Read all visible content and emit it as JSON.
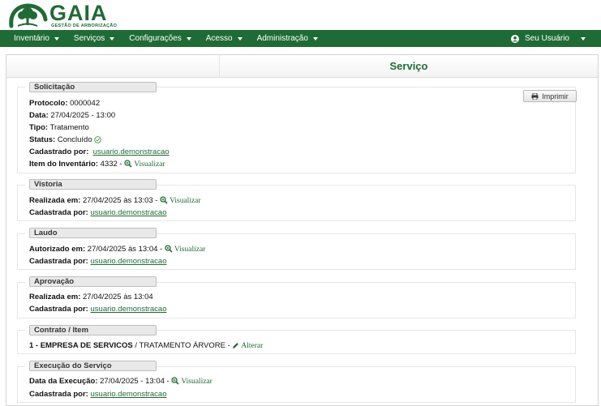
{
  "brand": {
    "name": "GAIA",
    "tagline": "GESTÃO DE ARBORIZAÇÃO"
  },
  "nav": {
    "items": [
      "Inventário",
      "Serviços",
      "Configurações",
      "Acesso",
      "Administração"
    ],
    "user": "Seu Usuário"
  },
  "colors": {
    "brand_green": "#1f6b35"
  },
  "page": {
    "title": "Serviço",
    "print_label": "Imprimir"
  },
  "solicitacao": {
    "legend": "Solicitação",
    "protocolo_label": "Protocolo:",
    "protocolo": "0000042",
    "data_label": "Data:",
    "data": "27/04/2025 - 13:00",
    "tipo_label": "Tipo:",
    "tipo": "Tratamento",
    "status_label": "Status:",
    "status": "Concluído",
    "cadastrado_label": "Cadastrado por:",
    "cadastrado": "usuario.demonstracao",
    "item_label": "Item do Inventário:",
    "item": "4332 -",
    "item_link": "Visualizar"
  },
  "vistoria": {
    "legend": "Vistoria",
    "realizada_label": "Realizada em:",
    "realizada": "27/04/2025 às 13:03 -",
    "link": "Visualizar",
    "cadastrada_label": "Cadastrada por:",
    "cadastrada": "usuario.demonstracao"
  },
  "laudo": {
    "legend": "Laudo",
    "autorizado_label": "Autorizado em:",
    "autorizado": "27/04/2025 às 13:04 -",
    "link": "Visualizar",
    "cadastrada_label": "Cadastrada por:",
    "cadastrada": "usuario.demonstracao"
  },
  "aprovacao": {
    "legend": "Aprovação",
    "realizada_label": "Realizada em:",
    "realizada": "27/04/2025 às 13:04",
    "cadastrada_label": "Cadastrada por:",
    "cadastrada": "usuario.demonstracao"
  },
  "contrato": {
    "legend": "Contrato / Item",
    "empresa": "1 - EMPRESA DE SERVICOS",
    "item": "/ TRATAMENTO ÁRVORE -",
    "link": "Alterar"
  },
  "execucao": {
    "legend": "Execução do Serviço",
    "data_label": "Data da Execução:",
    "data": "27/04/2025 - 13:04 -",
    "link": "Visualizar",
    "cadastrada_label": "Cadastrada por:",
    "cadastrada": "usuario.demonstracao"
  }
}
